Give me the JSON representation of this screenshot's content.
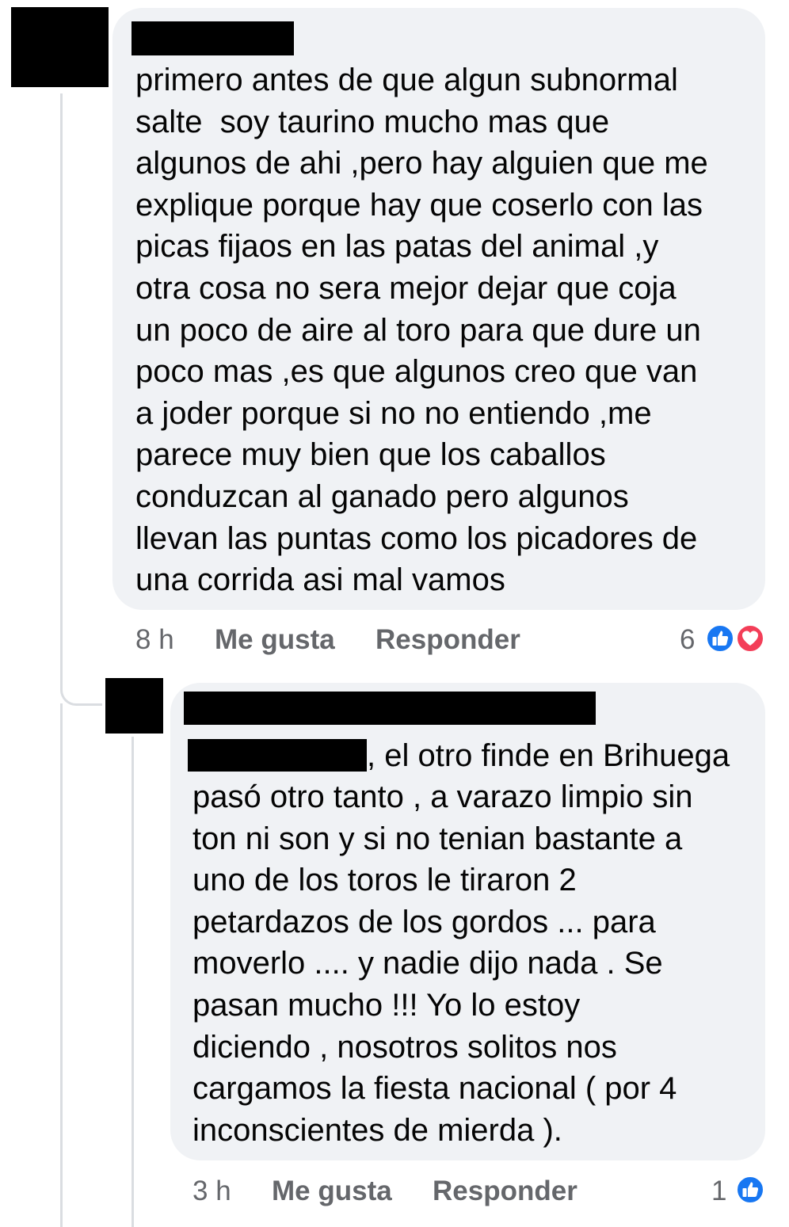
{
  "comment1": {
    "text_lines": [
      "primero antes de que algun subnormal",
      "salte  soy taurino mucho mas que",
      "algunos de ahi ,pero hay alguien que me",
      "explique porque hay que coserlo con las",
      "picas fijaos en las patas del animal ,y",
      "otra cosa no sera mejor dejar que coja",
      "un poco de aire al toro para que dure un",
      "poco mas ,es que algunos creo que van",
      "a joder porque si no no entiendo ,me",
      "parece muy bien que los caballos",
      "conduzcan al ganado pero algunos",
      "llevan las puntas como los picadores de",
      "una corrida asi mal vamos"
    ],
    "time": "8 h",
    "like_label": "Me gusta",
    "reply_label": "Responder",
    "reaction_count": "6",
    "reactions": [
      "like-icon",
      "love-icon"
    ]
  },
  "comment2": {
    "first_line_after_mention": ", el otro finde en Brihuega",
    "text_lines": [
      "pasó otro tanto , a varazo limpio sin",
      "ton ni son y si no tenian bastante a",
      "uno de los toros le tiraron 2",
      "petardazos de los gordos ... para",
      "moverlo .... y nadie dijo nada . Se",
      "pasan mucho !!! Yo lo estoy",
      "diciendo , nosotros solitos nos",
      "cargamos la fiesta nacional ( por 4",
      "inconscientes de mierda )."
    ],
    "time": "3 h",
    "like_label": "Me gusta",
    "reply_label": "Responder",
    "reaction_count": "1",
    "reactions": [
      "like-icon"
    ]
  },
  "colors": {
    "bubble": "#f0f2f5",
    "meta_text": "#65676b",
    "like_blue": "#1877f2",
    "love_red": "#f33e58",
    "thread_line": "#dadde1"
  }
}
